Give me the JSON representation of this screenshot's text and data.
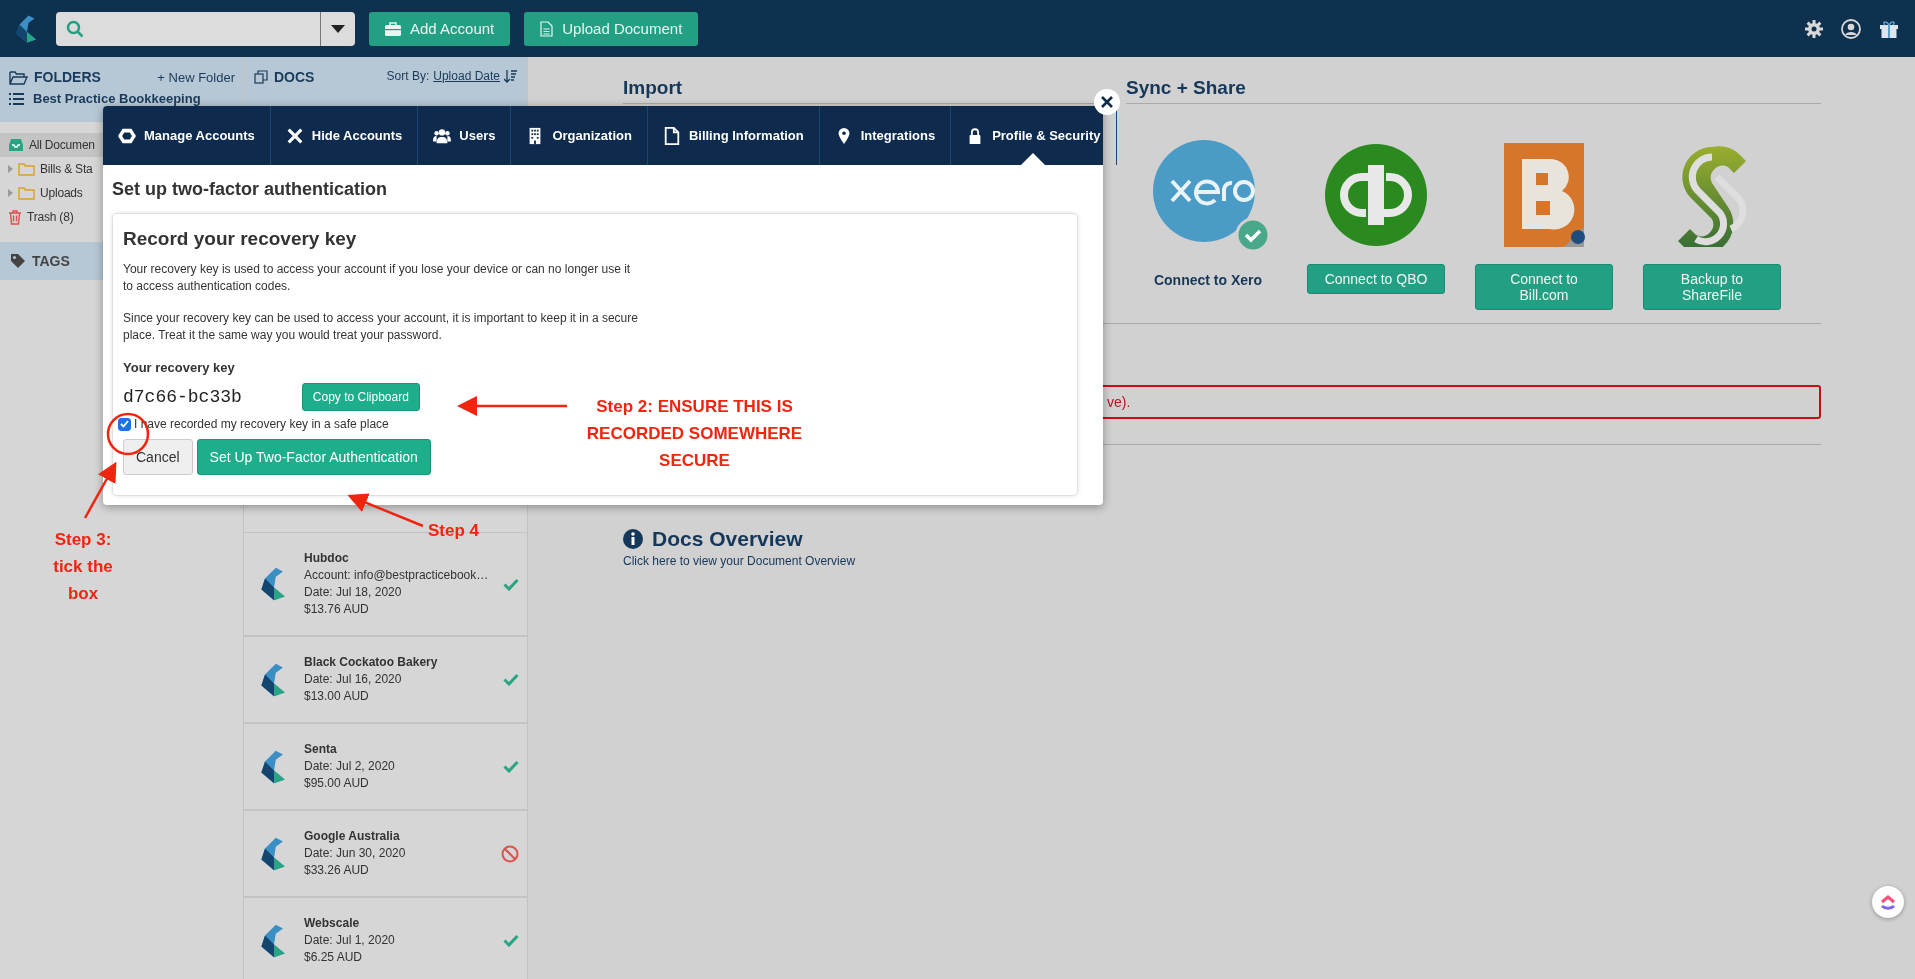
{
  "header": {
    "buttons": [
      {
        "label": "Add Account",
        "kind": "briefcase"
      },
      {
        "label": "Upload Document",
        "kind": "document"
      }
    ]
  },
  "folders": {
    "title": "FOLDERS",
    "new_folder": "+ New Folder",
    "account": "Best Practice Bookkeeping",
    "items": [
      {
        "label": "All Documen",
        "kind": "inbox",
        "selected": true
      },
      {
        "label": "Bills & Sta",
        "kind": "folder",
        "selected": false
      },
      {
        "label": "Uploads",
        "kind": "folder",
        "selected": false
      },
      {
        "label": "Trash (8)",
        "kind": "trash",
        "selected": false
      }
    ]
  },
  "tags": {
    "title": "TAGS"
  },
  "docs": {
    "title": "DOCS",
    "sort_label": "Sort By:",
    "sort_value": "Upload Date",
    "items": [
      {
        "name": "Hubdoc",
        "lines": [
          "Account: info@bestpracticebook…",
          "Date: Jul 18, 2020",
          "$13.76 AUD"
        ],
        "excluded": false
      },
      {
        "name": "Black Cockatoo Bakery",
        "lines": [
          "Date: Jul 16, 2020",
          "$13.00 AUD"
        ],
        "excluded": false
      },
      {
        "name": "Senta",
        "lines": [
          "Date: Jul 2, 2020",
          "$95.00 AUD"
        ],
        "excluded": false
      },
      {
        "name": "Google Australia",
        "lines": [
          "Date: Jun 30, 2020",
          "$33.26 AUD"
        ],
        "excluded": true
      },
      {
        "name": "Webscale",
        "lines": [
          "Date: Jul 1, 2020",
          "$6.25 AUD"
        ],
        "excluded": false
      }
    ]
  },
  "import": {
    "title": "Import"
  },
  "sync_share": {
    "title": "Sync + Share",
    "integrations": [
      {
        "kind": "xero",
        "label": "Connect to Xero",
        "connected": true
      },
      {
        "kind": "qbo",
        "label": "Connect to QBO",
        "connected": false
      },
      {
        "kind": "bill",
        "label": "Connect to Bill.com",
        "connected": false
      },
      {
        "kind": "sharefile",
        "label": "Backup to ShareFile",
        "connected": false
      }
    ]
  },
  "error_box": {
    "text": "ve)."
  },
  "docs_overview": {
    "title": "Docs Overview",
    "link": "Click here to view your Document Overview"
  },
  "modal": {
    "tabs": [
      {
        "label": "Manage Accounts",
        "kind": "hexagon",
        "selected": false
      },
      {
        "label": "Hide Accounts",
        "kind": "cross",
        "selected": false
      },
      {
        "label": "Users",
        "kind": "users",
        "selected": false
      },
      {
        "label": "Organization",
        "kind": "building",
        "selected": false
      },
      {
        "label": "Billing Information",
        "kind": "document",
        "selected": false
      },
      {
        "label": "Integrations",
        "kind": "pin",
        "selected": false
      },
      {
        "label": "Profile & Security",
        "kind": "lock",
        "selected": true
      }
    ],
    "heading": "Set up two-factor authentication",
    "card": {
      "title": "Record your recovery key",
      "paragraphs": [
        "Your recovery key is used to access your account if you lose your device or can no longer use it to access authentication codes.",
        "Since your recovery key can be used to access your account, it is important to keep it in a secure place. Treat it the same way you would treat your password."
      ],
      "key_label": "Your recovery key",
      "key": "d7c66-bc33b",
      "copy_button": "Copy to Clipboard",
      "confirm": {
        "label": "I have recorded my recovery key in a safe place",
        "checked": true
      },
      "buttons": [
        {
          "label": "Cancel",
          "kind": "secondary"
        },
        {
          "label": "Set Up Two-Factor Authentication",
          "kind": "primary"
        }
      ]
    }
  },
  "annotations": [
    {
      "text": "Step 2: ENSURE THIS IS RECORDED SOMEWHERE SECURE"
    },
    {
      "text": "Step 3: tick the box"
    },
    {
      "text": "Step 4"
    }
  ]
}
